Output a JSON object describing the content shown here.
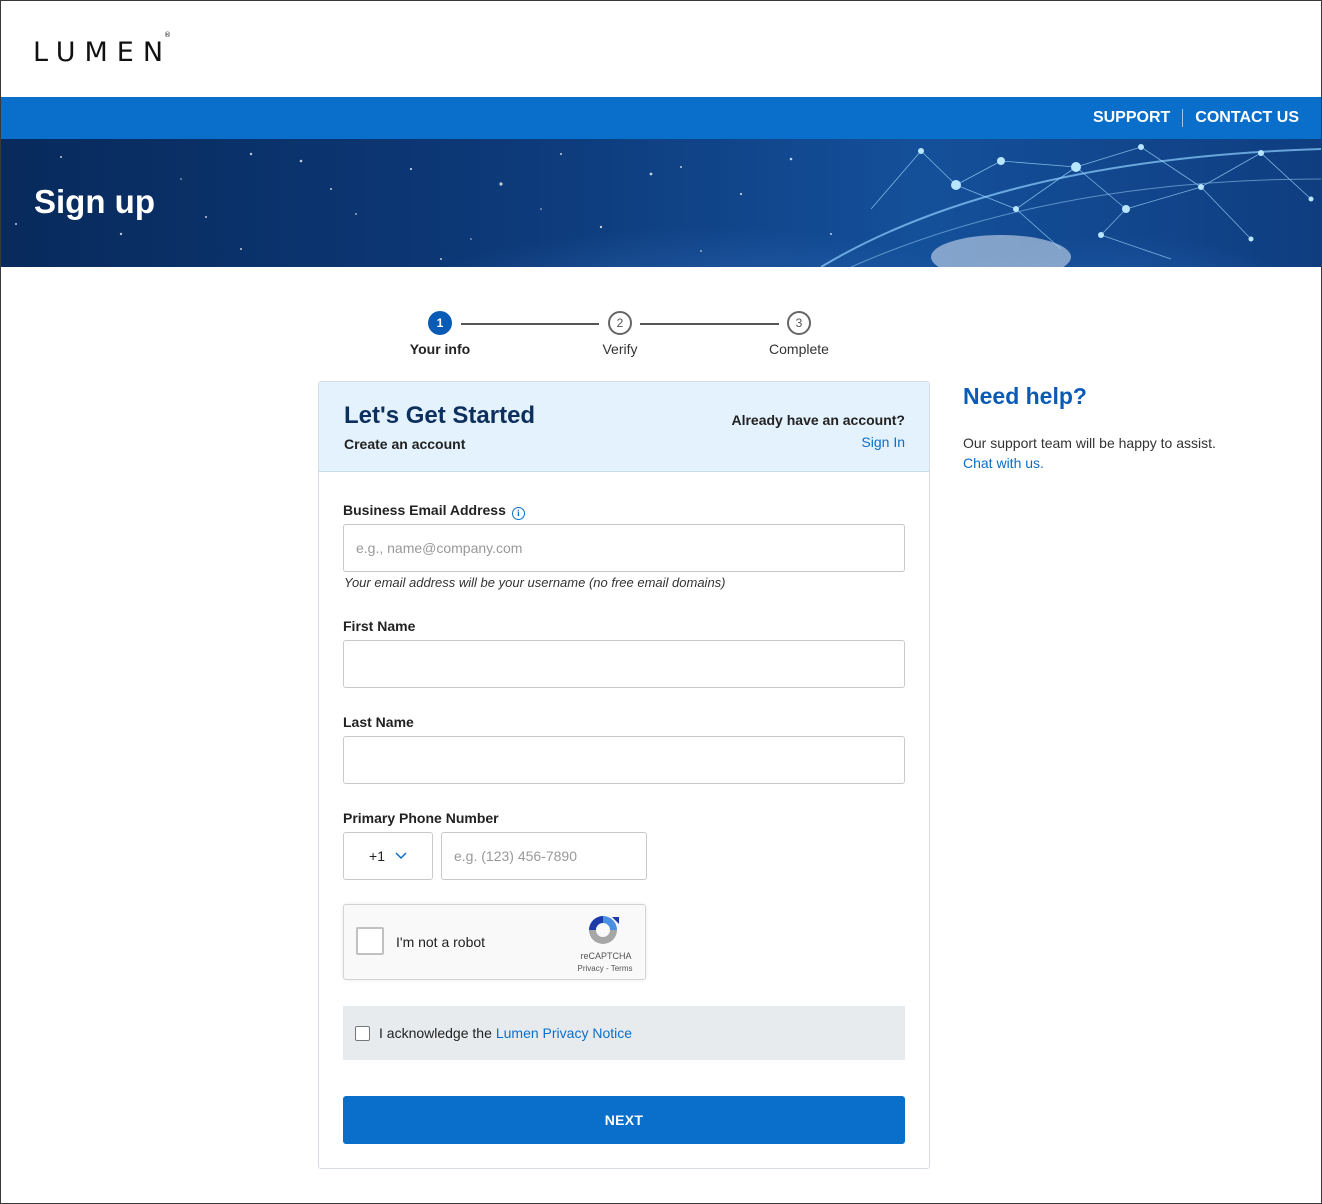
{
  "header": {
    "logo": "LUMEN",
    "logo_mark": "®",
    "nav": {
      "support": "SUPPORT",
      "contact": "CONTACT US"
    }
  },
  "hero": {
    "title": "Sign up"
  },
  "stepper": {
    "steps": [
      {
        "number": "1",
        "label": "Your info",
        "state": "active"
      },
      {
        "number": "2",
        "label": "Verify",
        "state": "pending"
      },
      {
        "number": "3",
        "label": "Complete",
        "state": "pending"
      }
    ]
  },
  "card": {
    "title": "Let's Get Started",
    "subtitle": "Create an account",
    "have_account": "Already have an account?",
    "sign_in": "Sign In"
  },
  "form": {
    "email": {
      "label": "Business Email Address",
      "placeholder": "e.g., name@company.com",
      "hint": "Your email address will be your username (no free email domains)"
    },
    "first_name": {
      "label": "First Name",
      "value": ""
    },
    "last_name": {
      "label": "Last Name",
      "value": ""
    },
    "phone": {
      "label": "Primary Phone Number",
      "country_code": "+1",
      "placeholder": "e.g. (123) 456-7890"
    },
    "recaptcha": {
      "label": "I'm not a robot",
      "brand": "reCAPTCHA",
      "links": "Privacy - Terms"
    },
    "acknowledge": {
      "text": "I acknowledge the",
      "link": "Lumen Privacy Notice"
    },
    "submit": "NEXT"
  },
  "help": {
    "title": "Need help?",
    "text": "Our support team will be happy to assist.",
    "link": "Chat with us."
  },
  "colors": {
    "brand_blue": "#0a6fcb",
    "header_tint": "#e3f2fc",
    "title_navy": "#0d2f5e"
  }
}
